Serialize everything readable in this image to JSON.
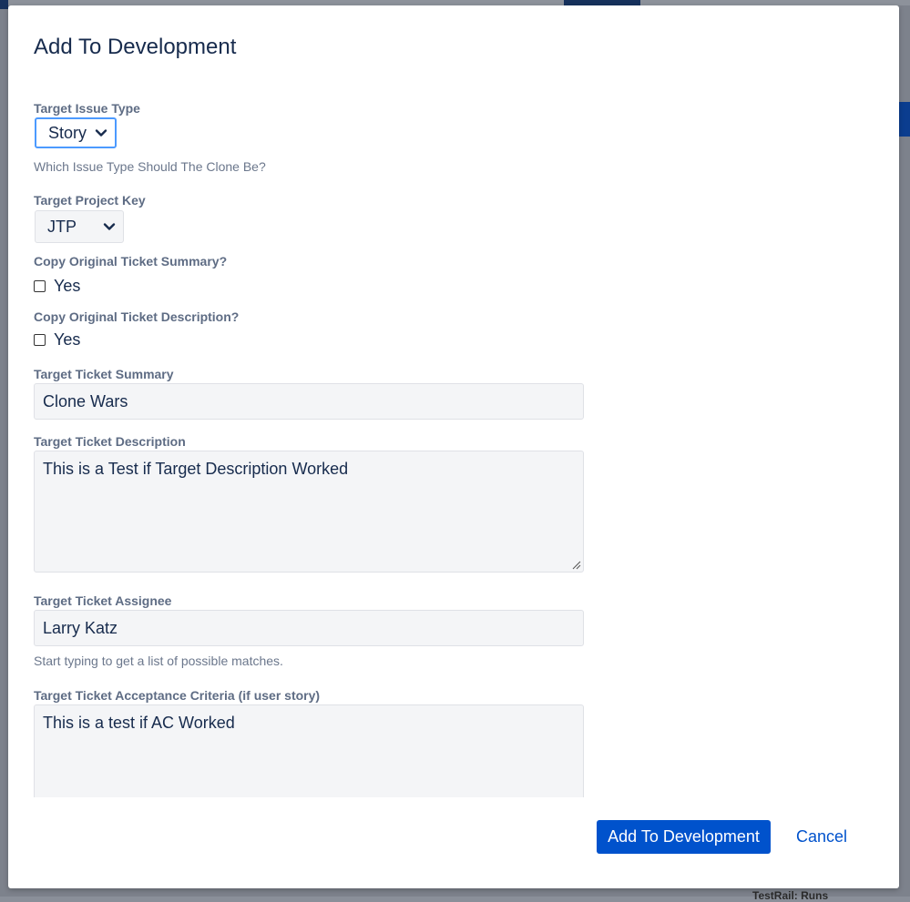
{
  "dialog": {
    "title": "Add To Development"
  },
  "form": {
    "issue_type": {
      "label": "Target Issue Type",
      "value": "Story",
      "help": "Which Issue Type Should The Clone Be?"
    },
    "project_key": {
      "label": "Target Project Key",
      "value": "JTP"
    },
    "copy_summary": {
      "label": "Copy Original Ticket Summary?",
      "option": "Yes",
      "checked": false
    },
    "copy_description": {
      "label": "Copy Original Ticket Description?",
      "option": "Yes",
      "checked": false
    },
    "summary": {
      "label": "Target Ticket Summary",
      "value": "Clone Wars"
    },
    "description": {
      "label": "Target Ticket Description",
      "value": "This is a Test if Target Description Worked"
    },
    "assignee": {
      "label": "Target Ticket Assignee",
      "value": "Larry Katz",
      "help": "Start typing to get a list of possible matches."
    },
    "acceptance_criteria": {
      "label": "Target Ticket Acceptance Criteria (if user story)",
      "value": "This is a test if AC Worked"
    }
  },
  "footer": {
    "submit_label": "Add To Development",
    "cancel_label": "Cancel"
  },
  "background": {
    "partial_text": "TestRail: Runs"
  },
  "colors": {
    "primary": "#0052cc",
    "focus_ring": "#4c9aff",
    "label": "#5e6c84",
    "text": "#172b4d",
    "overlay": "#7d828c"
  }
}
